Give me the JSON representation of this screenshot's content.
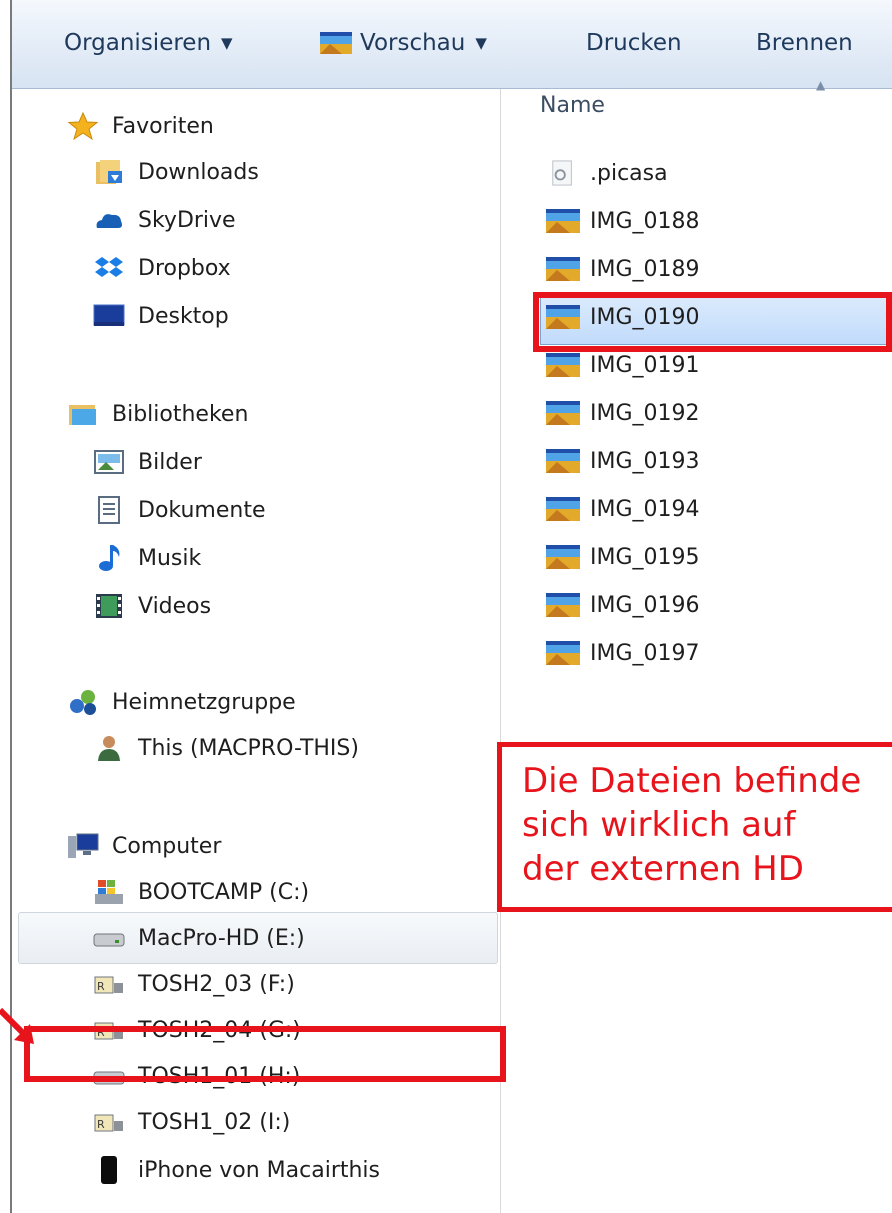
{
  "toolbar": {
    "organize": "Organisieren",
    "preview": "Vorschau",
    "print": "Drucken",
    "burn": "Brennen"
  },
  "nav": {
    "favorites": {
      "header": "Favoriten",
      "items": [
        "Downloads",
        "SkyDrive",
        "Dropbox",
        "Desktop"
      ]
    },
    "libraries": {
      "header": "Bibliotheken",
      "items": [
        "Bilder",
        "Dokumente",
        "Musik",
        "Videos"
      ]
    },
    "homegroup": {
      "header": "Heimnetzgruppe",
      "items": [
        "This (MACPRO-THIS)"
      ]
    },
    "computer": {
      "header": "Computer",
      "items": [
        "BOOTCAMP (C:)",
        "MacPro-HD (E:)",
        "TOSH2_03 (F:)",
        "TOSH2_04 (G:)",
        "TOSH1_01 (H:)",
        "TOSH1_02 (I:)",
        "iPhone von Macairthis"
      ]
    }
  },
  "files": {
    "column_name": "Name",
    "items": [
      ".picasa",
      "IMG_0188",
      "IMG_0189",
      "IMG_0190",
      "IMG_0191",
      "IMG_0192",
      "IMG_0193",
      "IMG_0194",
      "IMG_0195",
      "IMG_0196",
      "IMG_0197"
    ],
    "selected": "IMG_0190"
  },
  "annotation": {
    "lines": [
      "Die Dateien befinde",
      "sich wirklich auf",
      "der externen HD"
    ]
  },
  "colors": {
    "highlight_red": "#e8141c",
    "selection_blue": "#c1dbfc"
  }
}
